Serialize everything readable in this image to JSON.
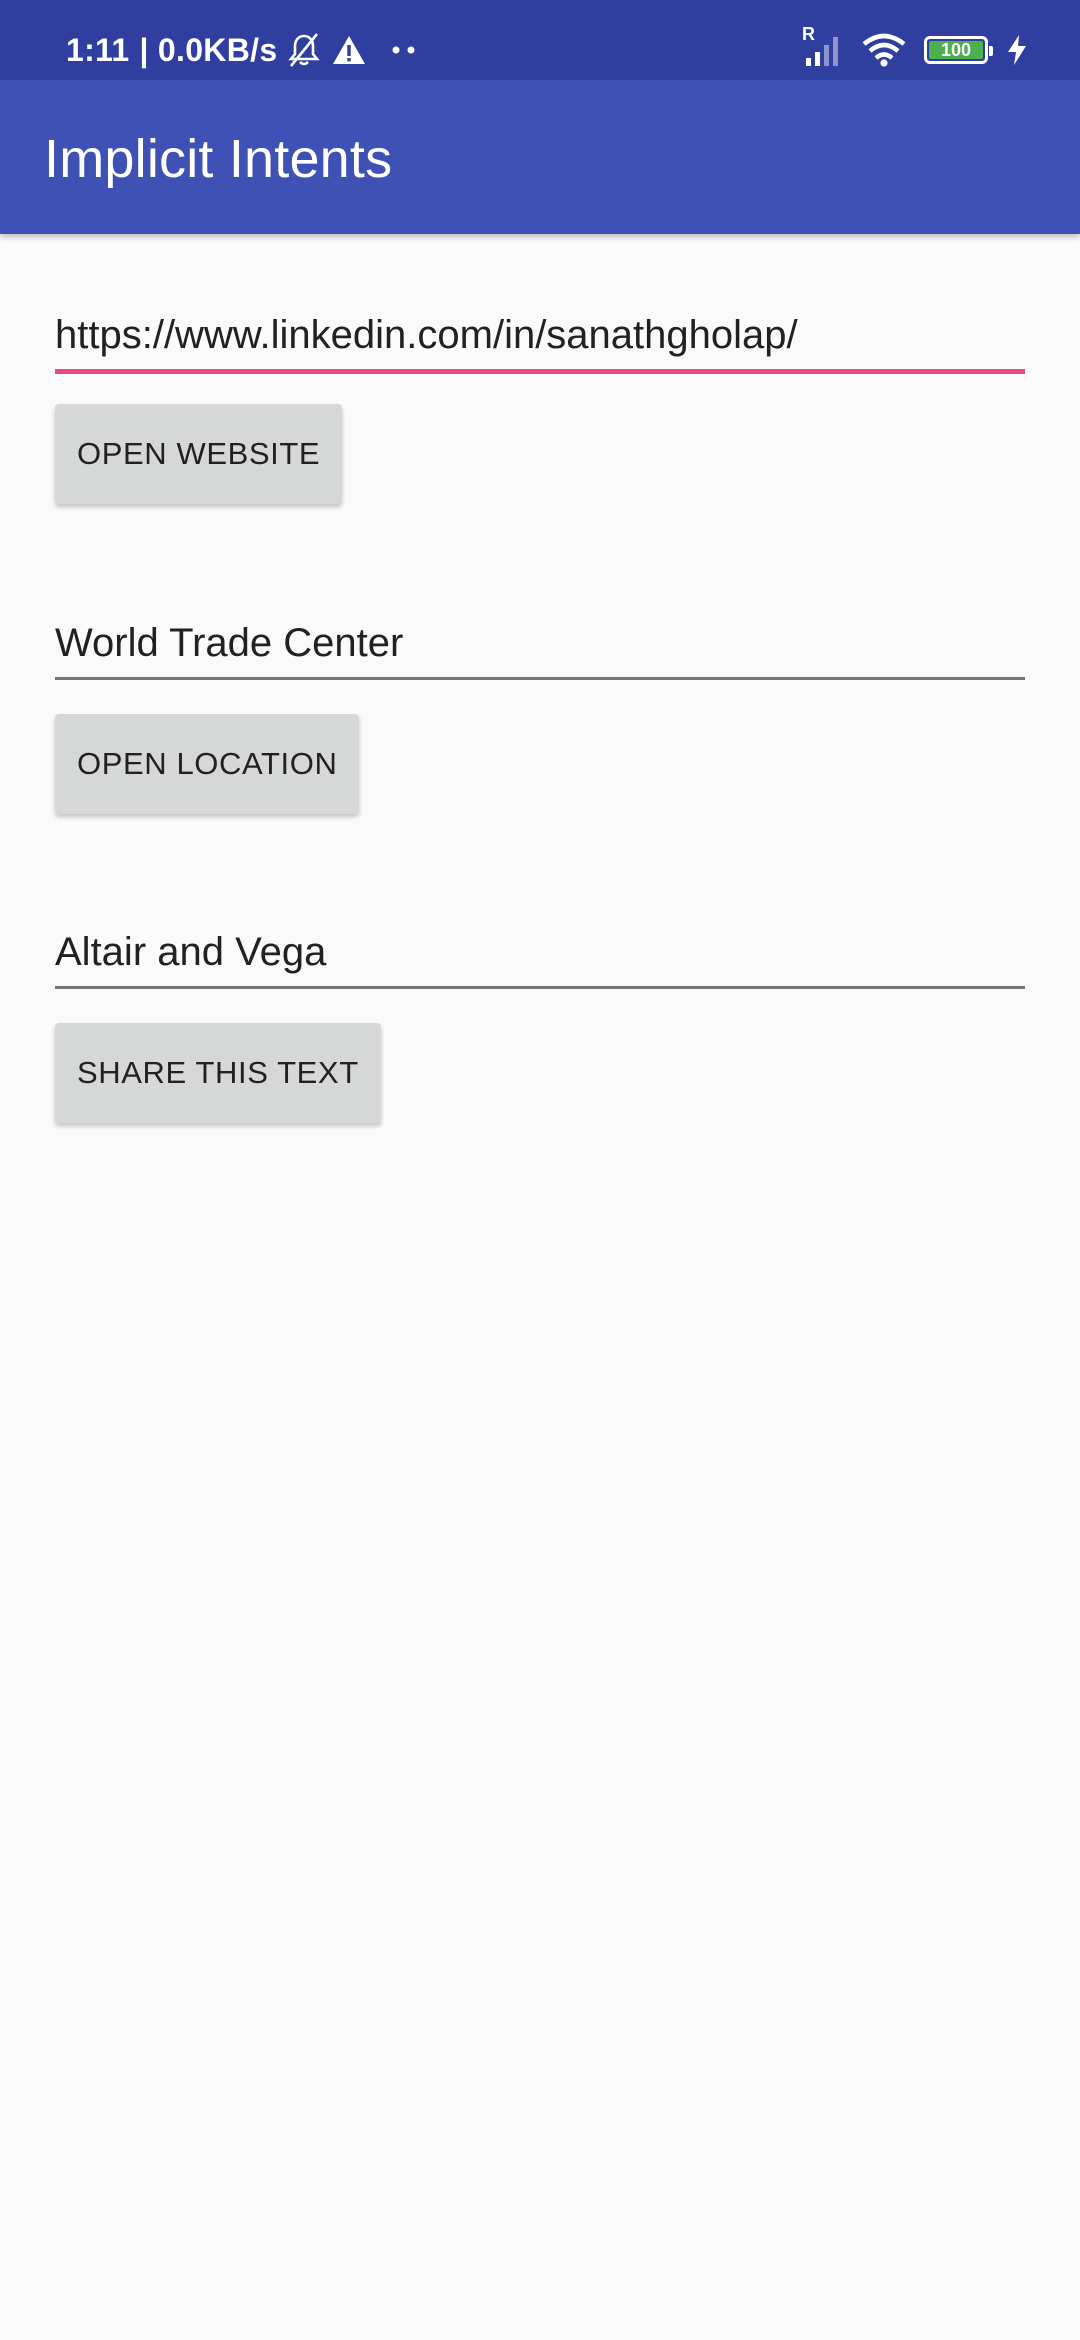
{
  "status_bar": {
    "time": "1:11",
    "network_speed": "| 0.0KB/s",
    "icons": [
      "mute-bell-icon",
      "alert-triangle-icon",
      "more-dots-icon",
      "signal-icon",
      "wifi-icon",
      "battery-icon",
      "charging-icon"
    ],
    "signal_label": "R",
    "battery_level": "100"
  },
  "app_bar": {
    "title": "Implicit Intents",
    "color": "#3f51b5",
    "status_color": "#303f9f"
  },
  "website": {
    "value": "https://www.linkedin.com/in/sanathgholap/",
    "button_label": "OPEN WEBSITE"
  },
  "location": {
    "value": "World Trade Center",
    "button_label": "OPEN LOCATION"
  },
  "share": {
    "value": "Altair and Vega",
    "button_label": "SHARE THIS TEXT"
  },
  "colors": {
    "accent": "#e94b7f",
    "button_bg": "#d6d7d7",
    "battery": "#4caf50"
  }
}
